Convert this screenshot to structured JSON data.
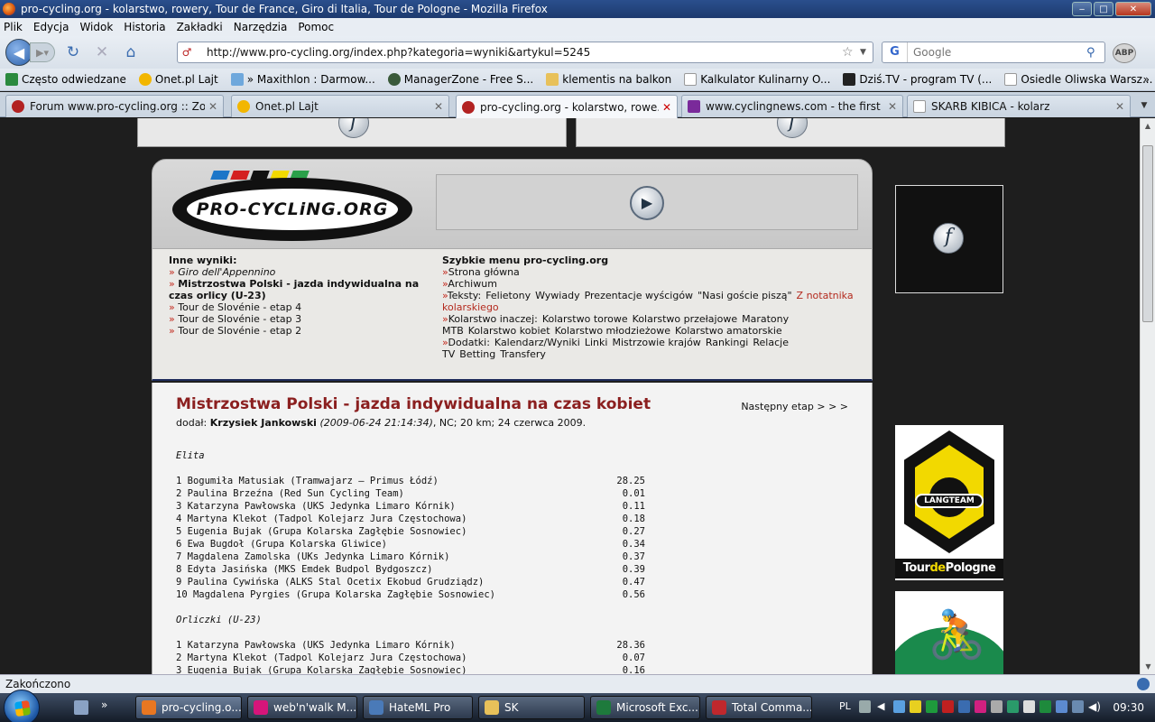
{
  "window": {
    "title": "pro-cycling.org - kolarstwo, rowery, Tour de France, Giro di Italia, Tour de Pologne - Mozilla Firefox",
    "buttons": {
      "minimize": "‒",
      "maximize": "□",
      "close": "✕"
    }
  },
  "menubar": {
    "items": [
      "Plik",
      "Edycja",
      "Widok",
      "Historia",
      "Zakładki",
      "Narzędzia",
      "Pomoc"
    ]
  },
  "navbar": {
    "url": "http://www.pro-cycling.org/index.php?kategoria=wyniki&artykul=5245",
    "search_placeholder": "Google",
    "search_engine": "G",
    "abp": "ABP"
  },
  "bookmarks": [
    {
      "label": "Często odwiedzane",
      "color": "#2b8a3e"
    },
    {
      "label": "Onet.pl Lajt",
      "color": "#f2b600"
    },
    {
      "label": "» Maxithlon : Darmow...",
      "color": "#6fa8dc"
    },
    {
      "label": "ManagerZone - Free S...",
      "color": "#3a5a3a"
    },
    {
      "label": "klementis na balkon",
      "color": "#e8c15a"
    },
    {
      "label": "Kalkulator Kulinarny O...",
      "color": "#ffffff"
    },
    {
      "label": "Dziś.TV - program TV (...",
      "color": "#222222"
    },
    {
      "label": "Osiedle Oliwska Warsz...",
      "color": "#ffffff"
    }
  ],
  "tabs": [
    {
      "label": "Forum www.pro-cycling.org :: Zoba...",
      "active": false,
      "color": "#b22222"
    },
    {
      "label": "Onet.pl Lajt",
      "active": false,
      "color": "#f2b600"
    },
    {
      "label": "pro-cycling.org - kolarstwo, rowe...",
      "active": true,
      "color": "#b22222"
    },
    {
      "label": "www.cyclingnews.com - the first W...",
      "active": false,
      "color": "#7a2a9a"
    },
    {
      "label": "SKARB KIBICA - kolarz",
      "active": false,
      "color": "#ffffff"
    }
  ],
  "site": {
    "logo_text": "PRO-CYCLiNG.ORG",
    "logo_stripe_colors": [
      "#1c76c8",
      "#d42020",
      "#111111",
      "#f2d900",
      "#2aa04a"
    ],
    "other_results": {
      "heading": "Inne wyniki:",
      "items": [
        {
          "label": "Giro dell'Appennino",
          "style": "italic"
        },
        {
          "label": "Mistrzostwa Polski - jazda indywidualna na czas orlicy (U-23)",
          "style": "bold"
        },
        {
          "label": "Tour de Slovénie - etap 4",
          "style": "normal"
        },
        {
          "label": "Tour de Slovénie - etap 3",
          "style": "normal"
        },
        {
          "label": "Tour de Slovénie - etap 2",
          "style": "normal"
        }
      ]
    },
    "quick_menu": {
      "heading": "Szybkie menu pro-cycling.org",
      "strona": "Strona główna",
      "archiwum": "Archiwum",
      "teksty_label": "Teksty:",
      "teksty": [
        "Felietony",
        "Wywiady",
        "Prezentacje wyścigów",
        "\"Nasi goście piszą\""
      ],
      "teksty_red": "Z notatnika kolarskiego",
      "inaczej_label": "Kolarstwo inaczej:",
      "inaczej": [
        "Kolarstwo torowe",
        "Kolarstwo przełajowe",
        "Maratony MTB",
        "Kolarstwo kobiet",
        "Kolarstwo młodzieżowe",
        "Kolarstwo amatorskie"
      ],
      "dodatki_label": "Dodatki:",
      "dodatki": [
        "Kalendarz/Wyniki",
        "Linki",
        "Mistrzowie krajów",
        "Rankingi",
        "Relacje TV",
        "Betting",
        "Transfery"
      ]
    },
    "article": {
      "title": "Mistrzostwa Polski - jazda indywidualna na czas kobiet",
      "next": "Następny etap > > >",
      "byline_prefix": "dodał:",
      "author": "Krzysiek Jankowski",
      "date": "(2009-06-24 21:14:34)",
      "meta": ", NC; 20 km; 24 czerwca 2009.",
      "elite_label": "Elita",
      "elite": [
        {
          "name": "1 Bogumiła Matusiak (Tramwajarz – Primus Łódź)",
          "time": "28.25"
        },
        {
          "name": "2 Paulina Brzeźna (Red Sun Cycling Team)",
          "time": "0.01"
        },
        {
          "name": "3 Katarzyna Pawłowska (UKS Jedynka Limaro Kórnik)",
          "time": "0.11"
        },
        {
          "name": "4 Martyna Klekot (Tadpol Kolejarz Jura Częstochowa)",
          "time": "0.18"
        },
        {
          "name": "5 Eugenia Bujak (Grupa Kolarska Zagłębie Sosnowiec)",
          "time": "0.27"
        },
        {
          "name": "6 Ewa Bugdoł (Grupa Kolarska Gliwice)",
          "time": "0.34"
        },
        {
          "name": "7 Magdalena Zamolska (UKs Jedynka Limaro Kórnik)",
          "time": "0.37"
        },
        {
          "name": "8 Edyta Jasińska (MKS Emdek Budpol Bydgoszcz)",
          "time": "0.39"
        },
        {
          "name": "9 Paulina Cywińska (ALKS Stal Ocetix Ekobud Grudziądz)",
          "time": "0.47"
        },
        {
          "name": "10 Magdalena Pyrgies (Grupa Kolarska Zagłębie Sosnowiec)",
          "time": "0.56"
        }
      ],
      "u23_label": "Orliczki (U-23)",
      "u23": [
        {
          "name": "1 Katarzyna Pawłowska (UKS Jedynka Limaro Kórnik)",
          "time": "28.36"
        },
        {
          "name": "2 Martyna Klekot (Tadpol Kolejarz Jura Częstochowa)",
          "time": "0.07"
        },
        {
          "name": "3 Eugenia Bujak (Grupa Kolarska Zagłębie Sosnowiec)",
          "time": "0.16"
        }
      ]
    },
    "ads": {
      "langteam": "LANGTEAM",
      "tdp_prefix": "Tour",
      "tdp_mid": "de",
      "tdp_suffix": "Pologne"
    }
  },
  "statusbar": {
    "text": "Zakończono"
  },
  "taskbar": {
    "items": [
      {
        "label": "pro-cycling.o...",
        "color": "#e87722",
        "active": true
      },
      {
        "label": "web'n'walk M...",
        "color": "#d6157a",
        "active": false
      },
      {
        "label": "HateML Pro",
        "color": "#4a7ab8",
        "active": false
      },
      {
        "label": "SK",
        "color": "#e8c15a",
        "active": false
      },
      {
        "label": "Microsoft Exc...",
        "color": "#1e7a3c",
        "active": false
      },
      {
        "label": "Total Comma...",
        "color": "#c0282d",
        "active": false
      }
    ],
    "lang": "PL",
    "clock": "09:30"
  }
}
